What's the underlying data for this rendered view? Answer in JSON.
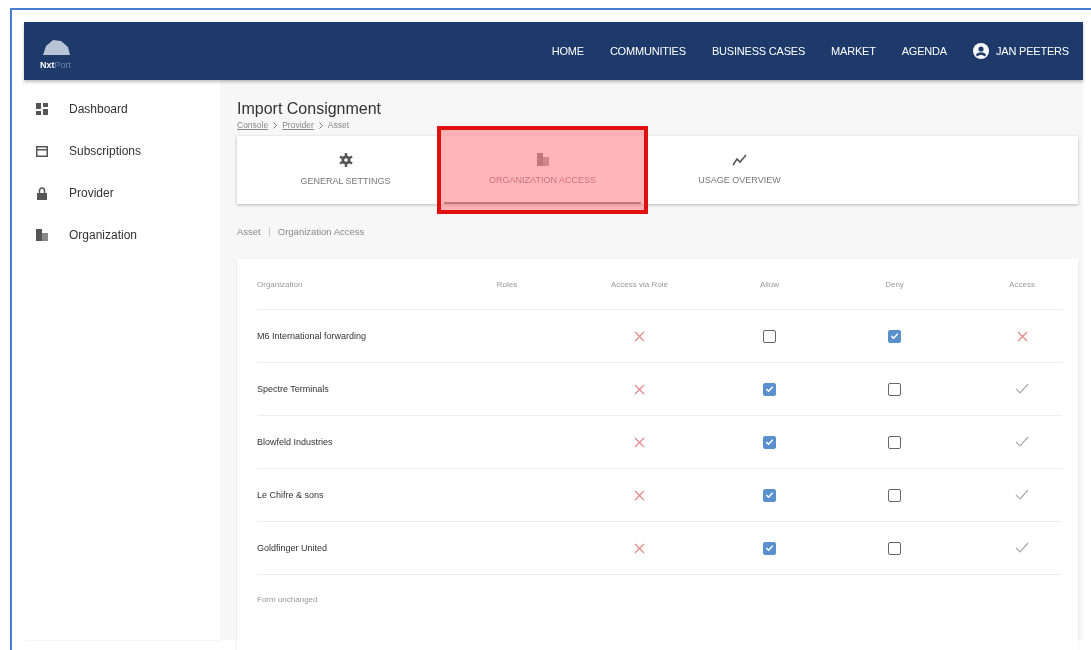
{
  "logo": "**Nxt**Port",
  "nav": [
    "HOME",
    "COMMUNITIES",
    "BUSINESS CASES",
    "MARKET",
    "AGENDA"
  ],
  "user": {
    "name": "JAN PEETERS"
  },
  "sidebar": {
    "items": [
      {
        "kind": "dashboard",
        "label": "Dashboard"
      },
      {
        "kind": "subscriptions",
        "label": "Subscriptions"
      },
      {
        "kind": "provider",
        "label": "Provider"
      },
      {
        "kind": "organization",
        "label": "Organization"
      }
    ]
  },
  "page": {
    "title": "Import Consignment",
    "breadcrumb": [
      {
        "label": "Console",
        "link": true
      },
      {
        "label": "Provider",
        "link": true
      },
      {
        "label": "Asset",
        "link": false
      }
    ]
  },
  "tabs": [
    {
      "kind": "settings",
      "label": "GENERAL SETTINGS",
      "selected": false,
      "highlighted": false
    },
    {
      "kind": "organization",
      "label": "ORGANIZATION ACCESS",
      "selected": true,
      "highlighted": true
    },
    {
      "kind": "usage",
      "label": "USAGE OVERVIEW",
      "selected": false,
      "highlighted": false
    }
  ],
  "sub_breadcrumb": [
    "Asset",
    "Organization Access"
  ],
  "table": {
    "columns": [
      "Organization",
      "Roles",
      "Access via Role",
      "Allow",
      "Deny",
      "Access"
    ],
    "rows": [
      {
        "organization": "M6 International forwarding",
        "access_via_role": false,
        "allow": false,
        "deny": true,
        "access": false
      },
      {
        "organization": "Spectre Terminals",
        "access_via_role": false,
        "allow": true,
        "deny": false,
        "access": true
      },
      {
        "organization": "Blowfeld Industries",
        "access_via_role": false,
        "allow": true,
        "deny": false,
        "access": true
      },
      {
        "organization": "Le Chifre & sons",
        "access_via_role": false,
        "allow": true,
        "deny": false,
        "access": true
      },
      {
        "organization": "Goldfinger United",
        "access_via_role": false,
        "allow": true,
        "deny": false,
        "access": true
      }
    ]
  },
  "form_status": "Form unchanged"
}
